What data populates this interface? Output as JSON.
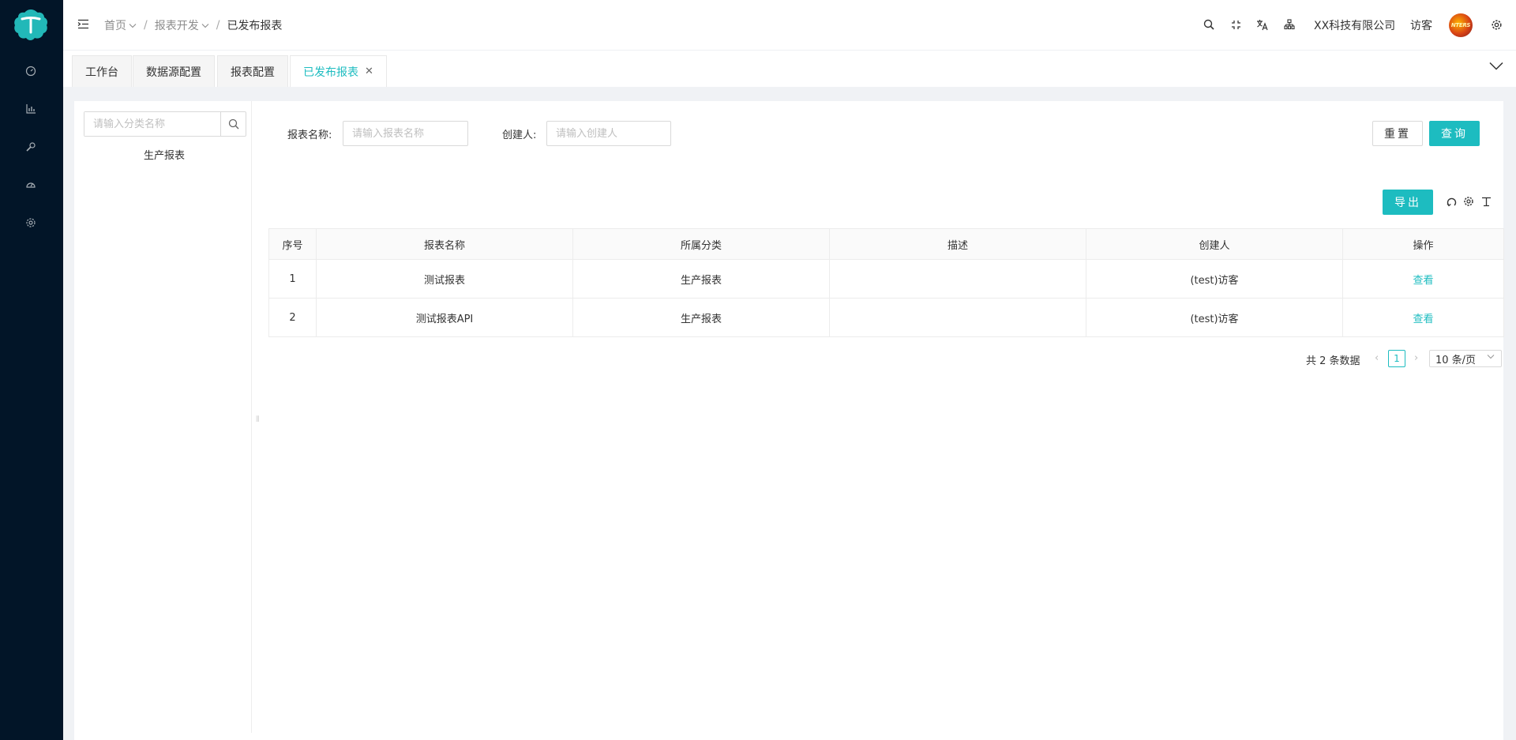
{
  "header": {
    "breadcrumbs": [
      {
        "label": "首页",
        "has_dropdown": true
      },
      {
        "label": "报表开发",
        "has_dropdown": true
      },
      {
        "label": "已发布报表",
        "has_dropdown": false
      }
    ],
    "company": "XX科技有限公司",
    "user": "访客",
    "avatar_text": "NTERS",
    "icons": [
      "search-icon",
      "fullscreen-icon",
      "translate-icon",
      "org-icon",
      "gear-icon"
    ]
  },
  "sidebar": {
    "icons": [
      "dashboard-icon",
      "chart-icon",
      "wrench-icon",
      "gauge-icon",
      "gear-icon"
    ]
  },
  "tabs": [
    {
      "label": "工作台",
      "active": false
    },
    {
      "label": "数据源配置",
      "active": false
    },
    {
      "label": "报表配置",
      "active": false
    },
    {
      "label": "已发布报表",
      "active": true,
      "closable": true
    }
  ],
  "tree": {
    "search_placeholder": "请输入分类名称",
    "nodes": [
      "生产报表"
    ]
  },
  "filters": {
    "report_name_label": "报表名称:",
    "report_name_placeholder": "请输入报表名称",
    "creator_label": "创建人:",
    "creator_placeholder": "请输入创建人",
    "reset_label": "重置",
    "query_label": "查询"
  },
  "toolbar": {
    "export_label": "导出",
    "icons": [
      "refresh-icon",
      "column-settings-icon",
      "density-icon"
    ]
  },
  "table": {
    "columns": [
      "序号",
      "报表名称",
      "所属分类",
      "描述",
      "创建人",
      "操作"
    ],
    "rows": [
      {
        "index": "1",
        "name": "测试报表",
        "category": "生产报表",
        "description": "",
        "creator": "(test)访客",
        "action": "查看"
      },
      {
        "index": "2",
        "name": "测试报表API",
        "category": "生产报表",
        "description": "",
        "creator": "(test)访客",
        "action": "查看"
      }
    ]
  },
  "pagination": {
    "total_text": "共 2 条数据",
    "current_page": "1",
    "page_size": "10 条/页"
  },
  "colors": {
    "accent": "#1dbcc0",
    "sidebar_bg": "#021528",
    "page_bg": "#f0f2f5"
  }
}
